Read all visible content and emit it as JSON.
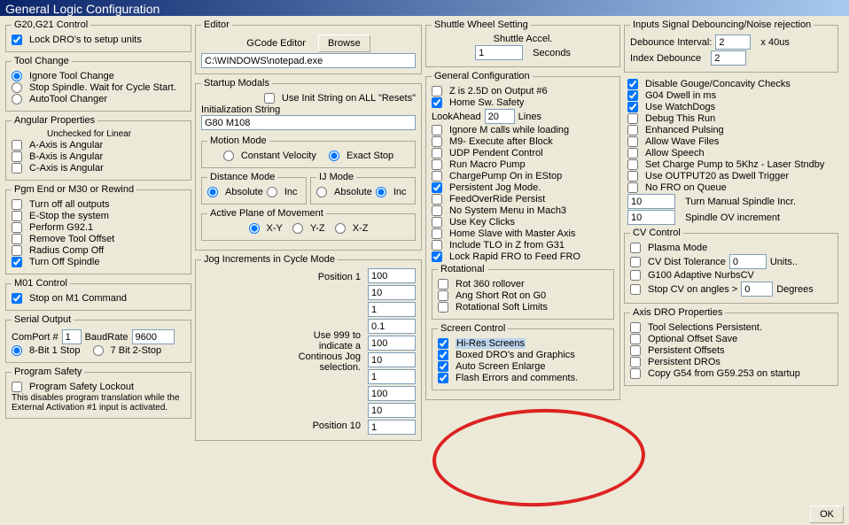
{
  "title": "General Logic Configuration",
  "ok_label": "OK",
  "g20g21": {
    "legend": "G20,G21 Control",
    "lock_dros": "Lock DRO's to setup units"
  },
  "toolchange": {
    "legend": "Tool Change",
    "ignore": "Ignore Tool Change",
    "stop_spindle": "Stop Spindle. Wait for Cycle Start.",
    "auto": "AutoTool Changer"
  },
  "angular": {
    "legend": "Angular Properties",
    "subtitle": "Unchecked for Linear",
    "a": "A-Axis is Angular",
    "b": "B-Axis is Angular",
    "c": "C-Axis is Angular"
  },
  "pgmend": {
    "legend": "Pgm End or M30 or Rewind",
    "turnoff_outputs": "Turn off all outputs",
    "estop": "E-Stop the system",
    "g921": "Perform G92.1",
    "remove_offset": "Remove Tool Offset",
    "radius_comp_off": "Radius Comp Off",
    "turnoff_spindle": "Turn Off Spindle"
  },
  "m01": {
    "legend": "M01 Control",
    "stop_on_m1": "Stop on M1 Command"
  },
  "serial": {
    "legend": "Serial Output",
    "comport_label": "ComPort #",
    "comport_val": "1",
    "baud_label": "BaudRate",
    "baud_val": "9600",
    "mode8": "8-Bit 1 Stop",
    "mode7": "7 Bit 2-Stop"
  },
  "safety": {
    "legend": "Program Safety",
    "lockout": "Program Safety Lockout",
    "note1": "This disables program translation while the",
    "note2": "External Activation #1 input is activated."
  },
  "editor": {
    "legend": "Editor",
    "gcode_editor": "GCode Editor",
    "browse": "Browse",
    "path": "C:\\WINDOWS\\notepad.exe"
  },
  "startup": {
    "legend": "Startup Modals",
    "use_init": "Use Init String on ALL  \"Resets\"",
    "init_label": "Initialization String",
    "init_val": "G80 M108",
    "motion_legend": "Motion Mode",
    "cv": "Constant Velocity",
    "es": "Exact Stop",
    "dist_legend": "Distance Mode",
    "ij_legend": "IJ Mode",
    "abs": "Absolute",
    "inc": "Inc",
    "plane_legend": "Active Plane of Movement",
    "xy": "X-Y",
    "yz": "Y-Z",
    "xz": "X-Z"
  },
  "jog": {
    "legend": "Jog Increments in Cycle Mode",
    "pos1": "Position 1",
    "pos10": "Position 10",
    "hint1": "Use 999 to",
    "hint2": "indicate a",
    "hint3": "Continous Jog",
    "hint4": "selection.",
    "v": [
      "100",
      "10",
      "1",
      "0.1",
      "100",
      "10",
      "1",
      "100",
      "10",
      "1"
    ]
  },
  "shuttle": {
    "legend": "Shuttle Wheel Setting",
    "accel_label": "Shuttle Accel.",
    "accel_val": "1",
    "seconds": "Seconds"
  },
  "general": {
    "legend": "General Configuration",
    "z25d": "Z is 2.5D on Output #6",
    "home_sw": "Home Sw. Safety",
    "lookahead": "LookAhead",
    "lookahead_val": "20",
    "lines": "Lines",
    "ignore_m": "Ignore M calls while loading",
    "m9": "M9- Execute after Block",
    "udp": "UDP Pendent Control",
    "run_macro": "Run Macro Pump",
    "charge": "ChargePump On in EStop",
    "pjog": "Persistent Jog Mode.",
    "fovr": "FeedOverRide Persist",
    "nosys": "No System Menu in Mach3",
    "keyclicks": "Use Key Clicks",
    "homeslave": "Home Slave with Master Axis",
    "tlo": "Include TLO in Z from G31",
    "lock_rapid": "Lock Rapid FRO to Feed FRO",
    "rot_legend": "Rotational",
    "rot360": "Rot 360 rollover",
    "angshort": "Ang Short Rot on G0",
    "rotsoft": "Rotational Soft Limits",
    "sc_legend": "Screen Control",
    "hires": "Hi-Res Screens",
    "boxed": "Boxed DRO's and Graphics",
    "autoenlarge": "Auto Screen Enlarge",
    "flash": "Flash Errors and comments."
  },
  "debounce": {
    "legend": "Inputs Signal Debouncing/Noise rejection",
    "interval": "Debounce Interval:",
    "interval_val": "2",
    "x40us": "x 40us",
    "index": "Index Debounce",
    "index_val": "2"
  },
  "right": {
    "disable_gouge": "Disable Gouge/Concavity Checks",
    "g04": "G04 Dwell in ms",
    "watchdogs": "Use WatchDogs",
    "debug": "Debug This Run",
    "pulsing": "Enhanced Pulsing",
    "wave": "Allow Wave Files",
    "speech": "Allow Speech",
    "charge5k": "Set Charge Pump to 5Khz  -  Laser Stndby",
    "output20": "Use OUTPUT20 as Dwell Trigger",
    "nofro": "No FRO on Queue",
    "man_spindle_val": "10",
    "man_spindle": "Turn Manual Spindle Incr.",
    "ov_val": "10",
    "ov": "Spindle OV increment"
  },
  "cv": {
    "legend": "CV Control",
    "plasma": "Plasma Mode",
    "tolerance": "CV Dist Tolerance",
    "tol_val": "0",
    "units": "Units..",
    "g100": "G100 Adaptive NurbsCV",
    "stopcv": "Stop CV on angles >",
    "stopcv_val": "0",
    "degrees": "Degrees"
  },
  "axisdro": {
    "legend": "Axis DRO Properties",
    "toolsel": "Tool Selections Persistent.",
    "offsetsave": "Optional Offset Save",
    "poffsets": "Persistent Offsets",
    "pdros": "Persistent DROs",
    "copyg54": "Copy G54 from G59.253 on startup"
  }
}
